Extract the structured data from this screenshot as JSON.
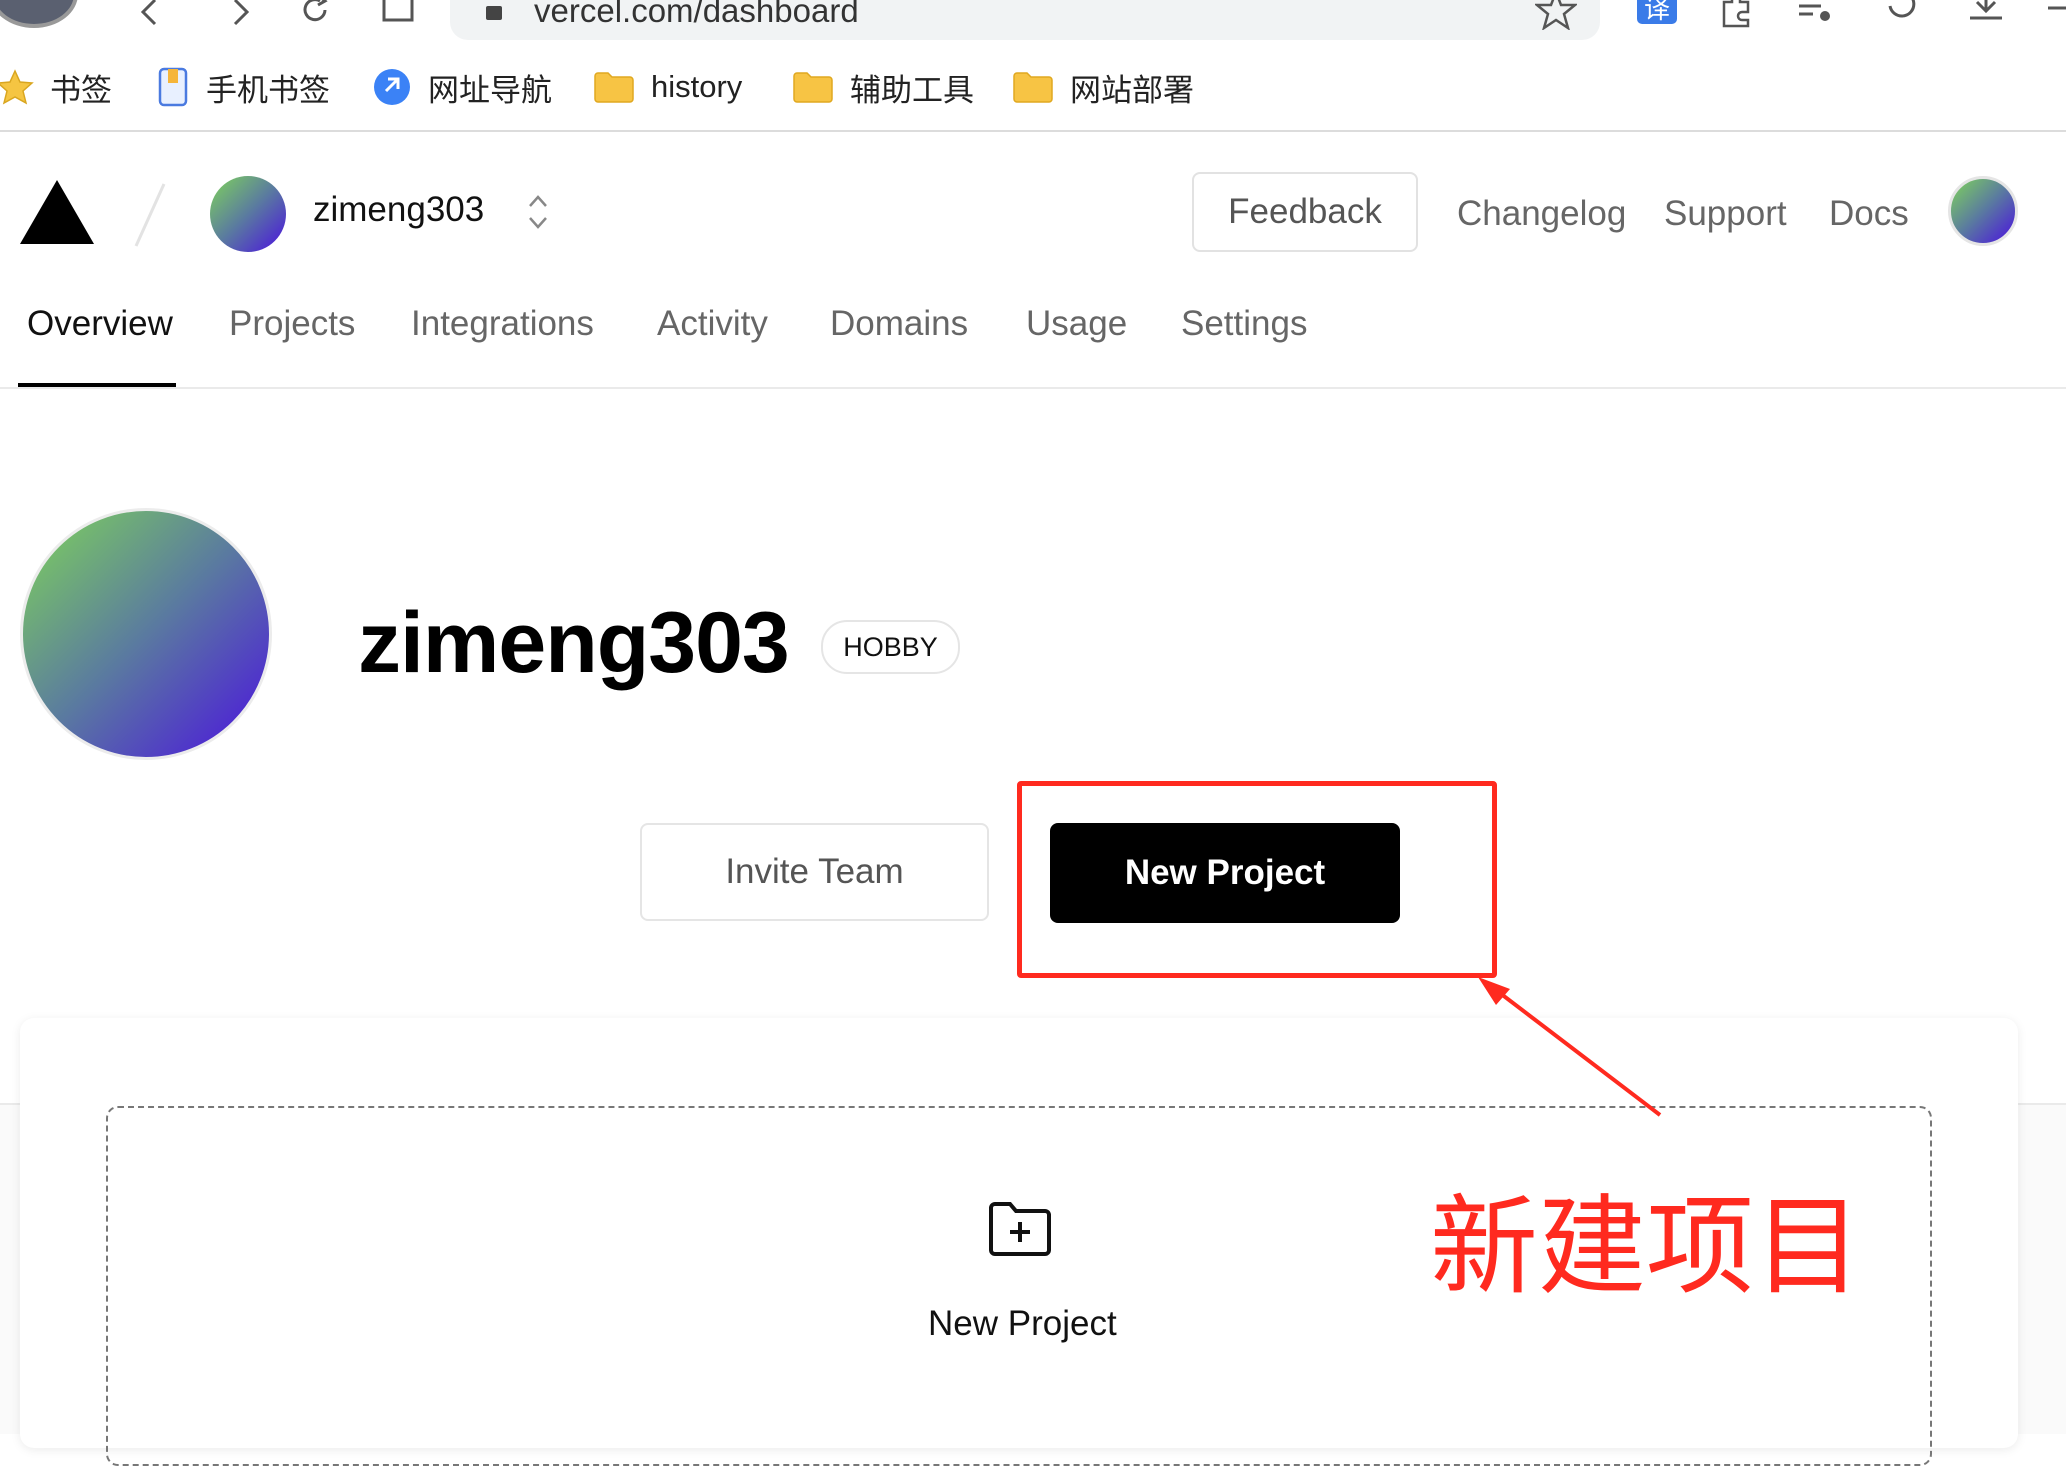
{
  "browser": {
    "url": "vercel.com/dashboard",
    "translate_badge": "译"
  },
  "bookmarks": {
    "items": [
      {
        "label": "书签",
        "icon": "star-icon"
      },
      {
        "label": "手机书签",
        "icon": "phone-bookmark-icon"
      },
      {
        "label": "网址导航",
        "icon": "navigation-icon"
      },
      {
        "label": "history",
        "icon": "folder-icon"
      },
      {
        "label": "辅助工具",
        "icon": "folder-icon"
      },
      {
        "label": "网站部署",
        "icon": "folder-icon"
      }
    ]
  },
  "header": {
    "username": "zimeng303",
    "feedback_label": "Feedback",
    "links": [
      "Changelog",
      "Support",
      "Docs"
    ]
  },
  "tabs": [
    "Overview",
    "Projects",
    "Integrations",
    "Activity",
    "Domains",
    "Usage",
    "Settings"
  ],
  "profile": {
    "name": "zimeng303",
    "plan_badge": "HOBBY"
  },
  "actions": {
    "invite_label": "Invite Team",
    "new_project_label": "New Project"
  },
  "empty_card": {
    "label": "New Project"
  },
  "annotation": {
    "text": "新建项目",
    "color": "#ff2a1f"
  },
  "colors": {
    "accent_black": "#000000",
    "annotation_red": "#ff2a1f"
  }
}
